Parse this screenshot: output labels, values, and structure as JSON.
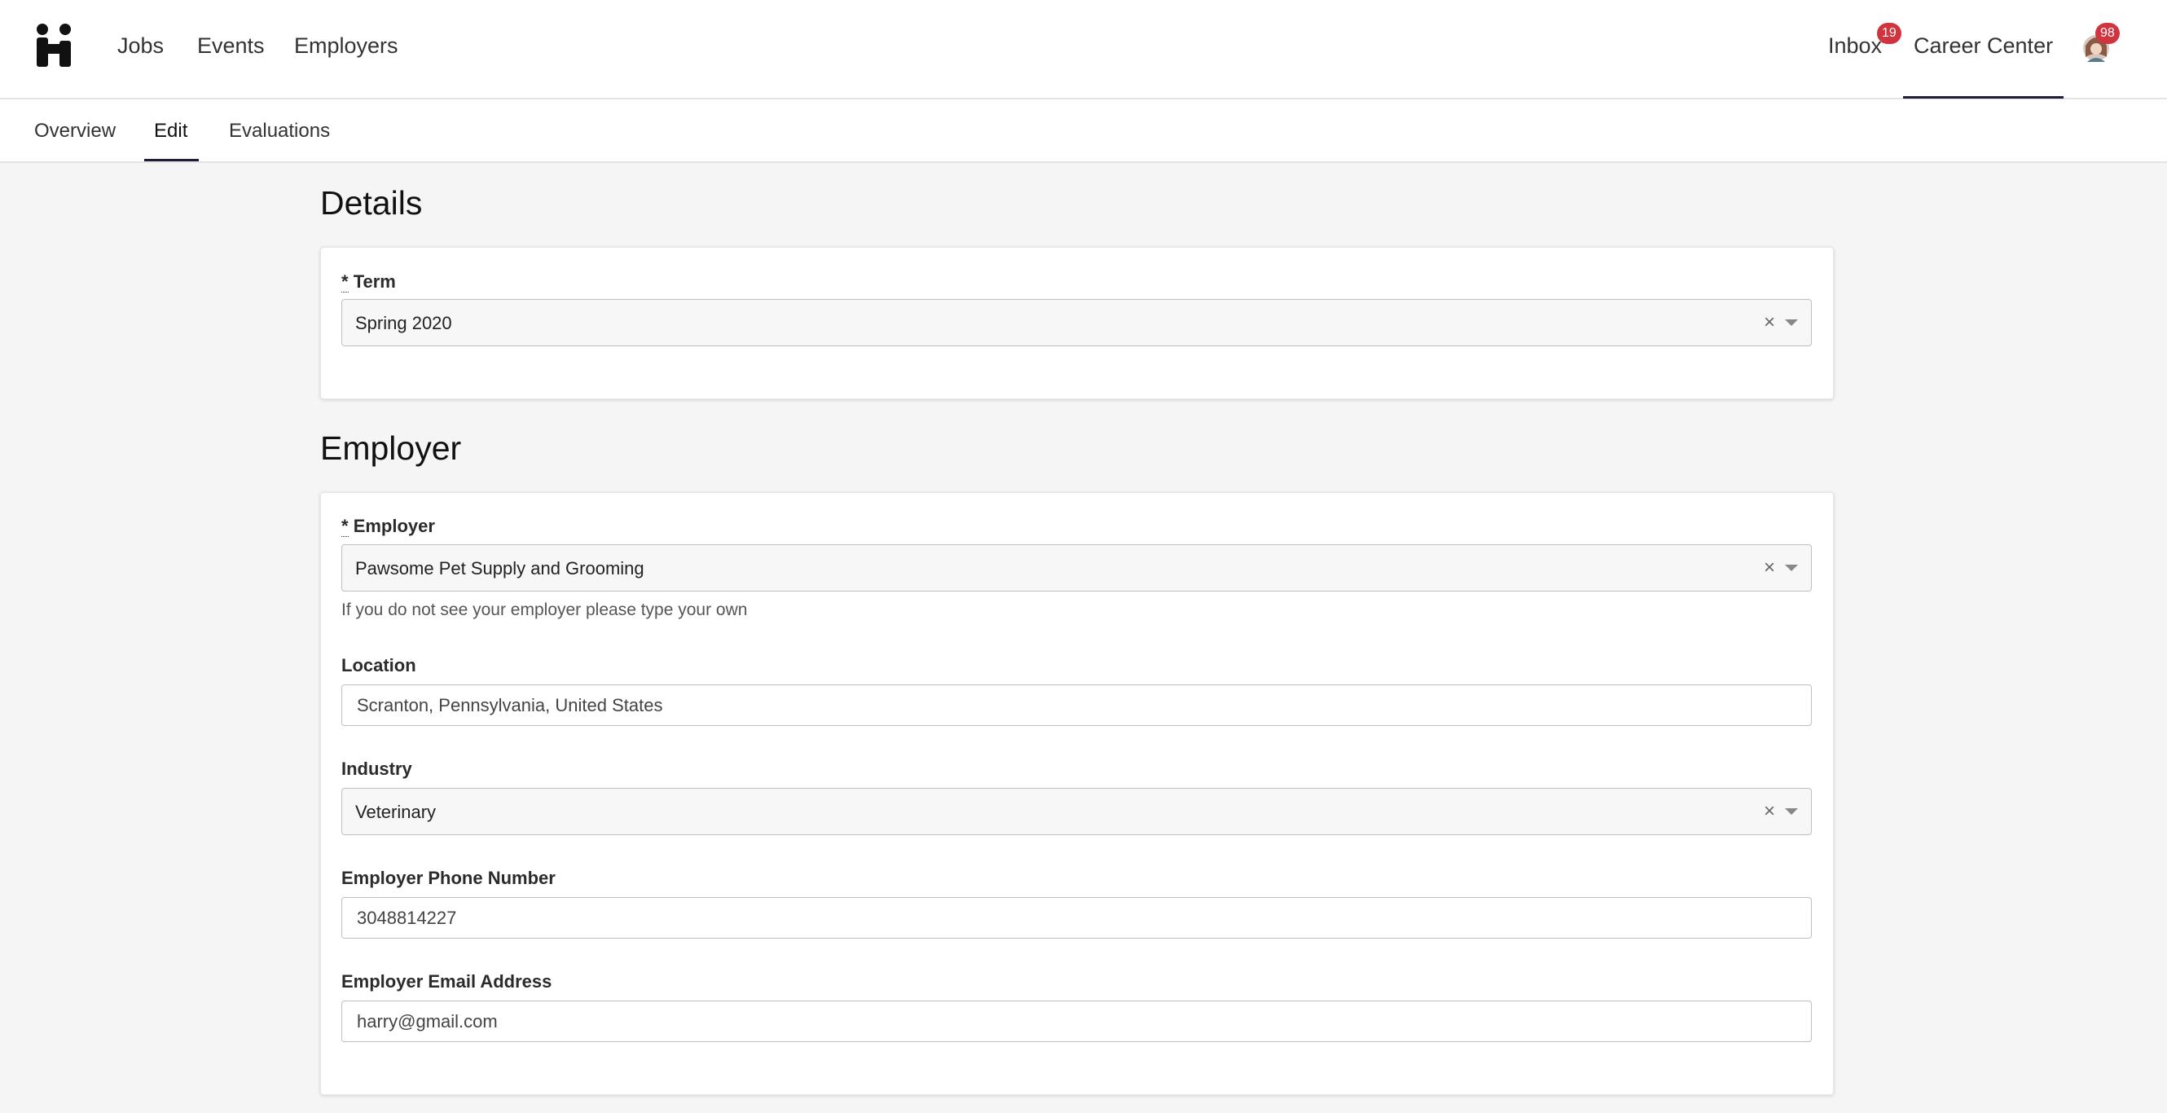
{
  "topnav": {
    "links": [
      "Jobs",
      "Events",
      "Employers"
    ],
    "inbox_label": "Inbox",
    "inbox_badge": "19",
    "career_center_label": "Career Center",
    "avatar_badge": "98"
  },
  "subnav": {
    "tabs": [
      "Overview",
      "Edit",
      "Evaluations"
    ],
    "active": "Edit"
  },
  "details": {
    "title": "Details",
    "term_required": "*",
    "term_label": "Term",
    "term_value": "Spring 2020"
  },
  "employer": {
    "title": "Employer",
    "employer_required": "*",
    "employer_label": "Employer",
    "employer_value": "Pawsome Pet Supply and Grooming",
    "employer_help": "If you do not see your employer please type your own",
    "location_label": "Location",
    "location_value": "Scranton, Pennsylvania, United States",
    "industry_label": "Industry",
    "industry_value": "Veterinary",
    "phone_label": "Employer Phone Number",
    "phone_value": "3048814227",
    "email_label": "Employer Email Address",
    "email_value": "harry@gmail.com"
  },
  "colors": {
    "accent": "#1d1d3b",
    "badge": "#d0343f"
  }
}
